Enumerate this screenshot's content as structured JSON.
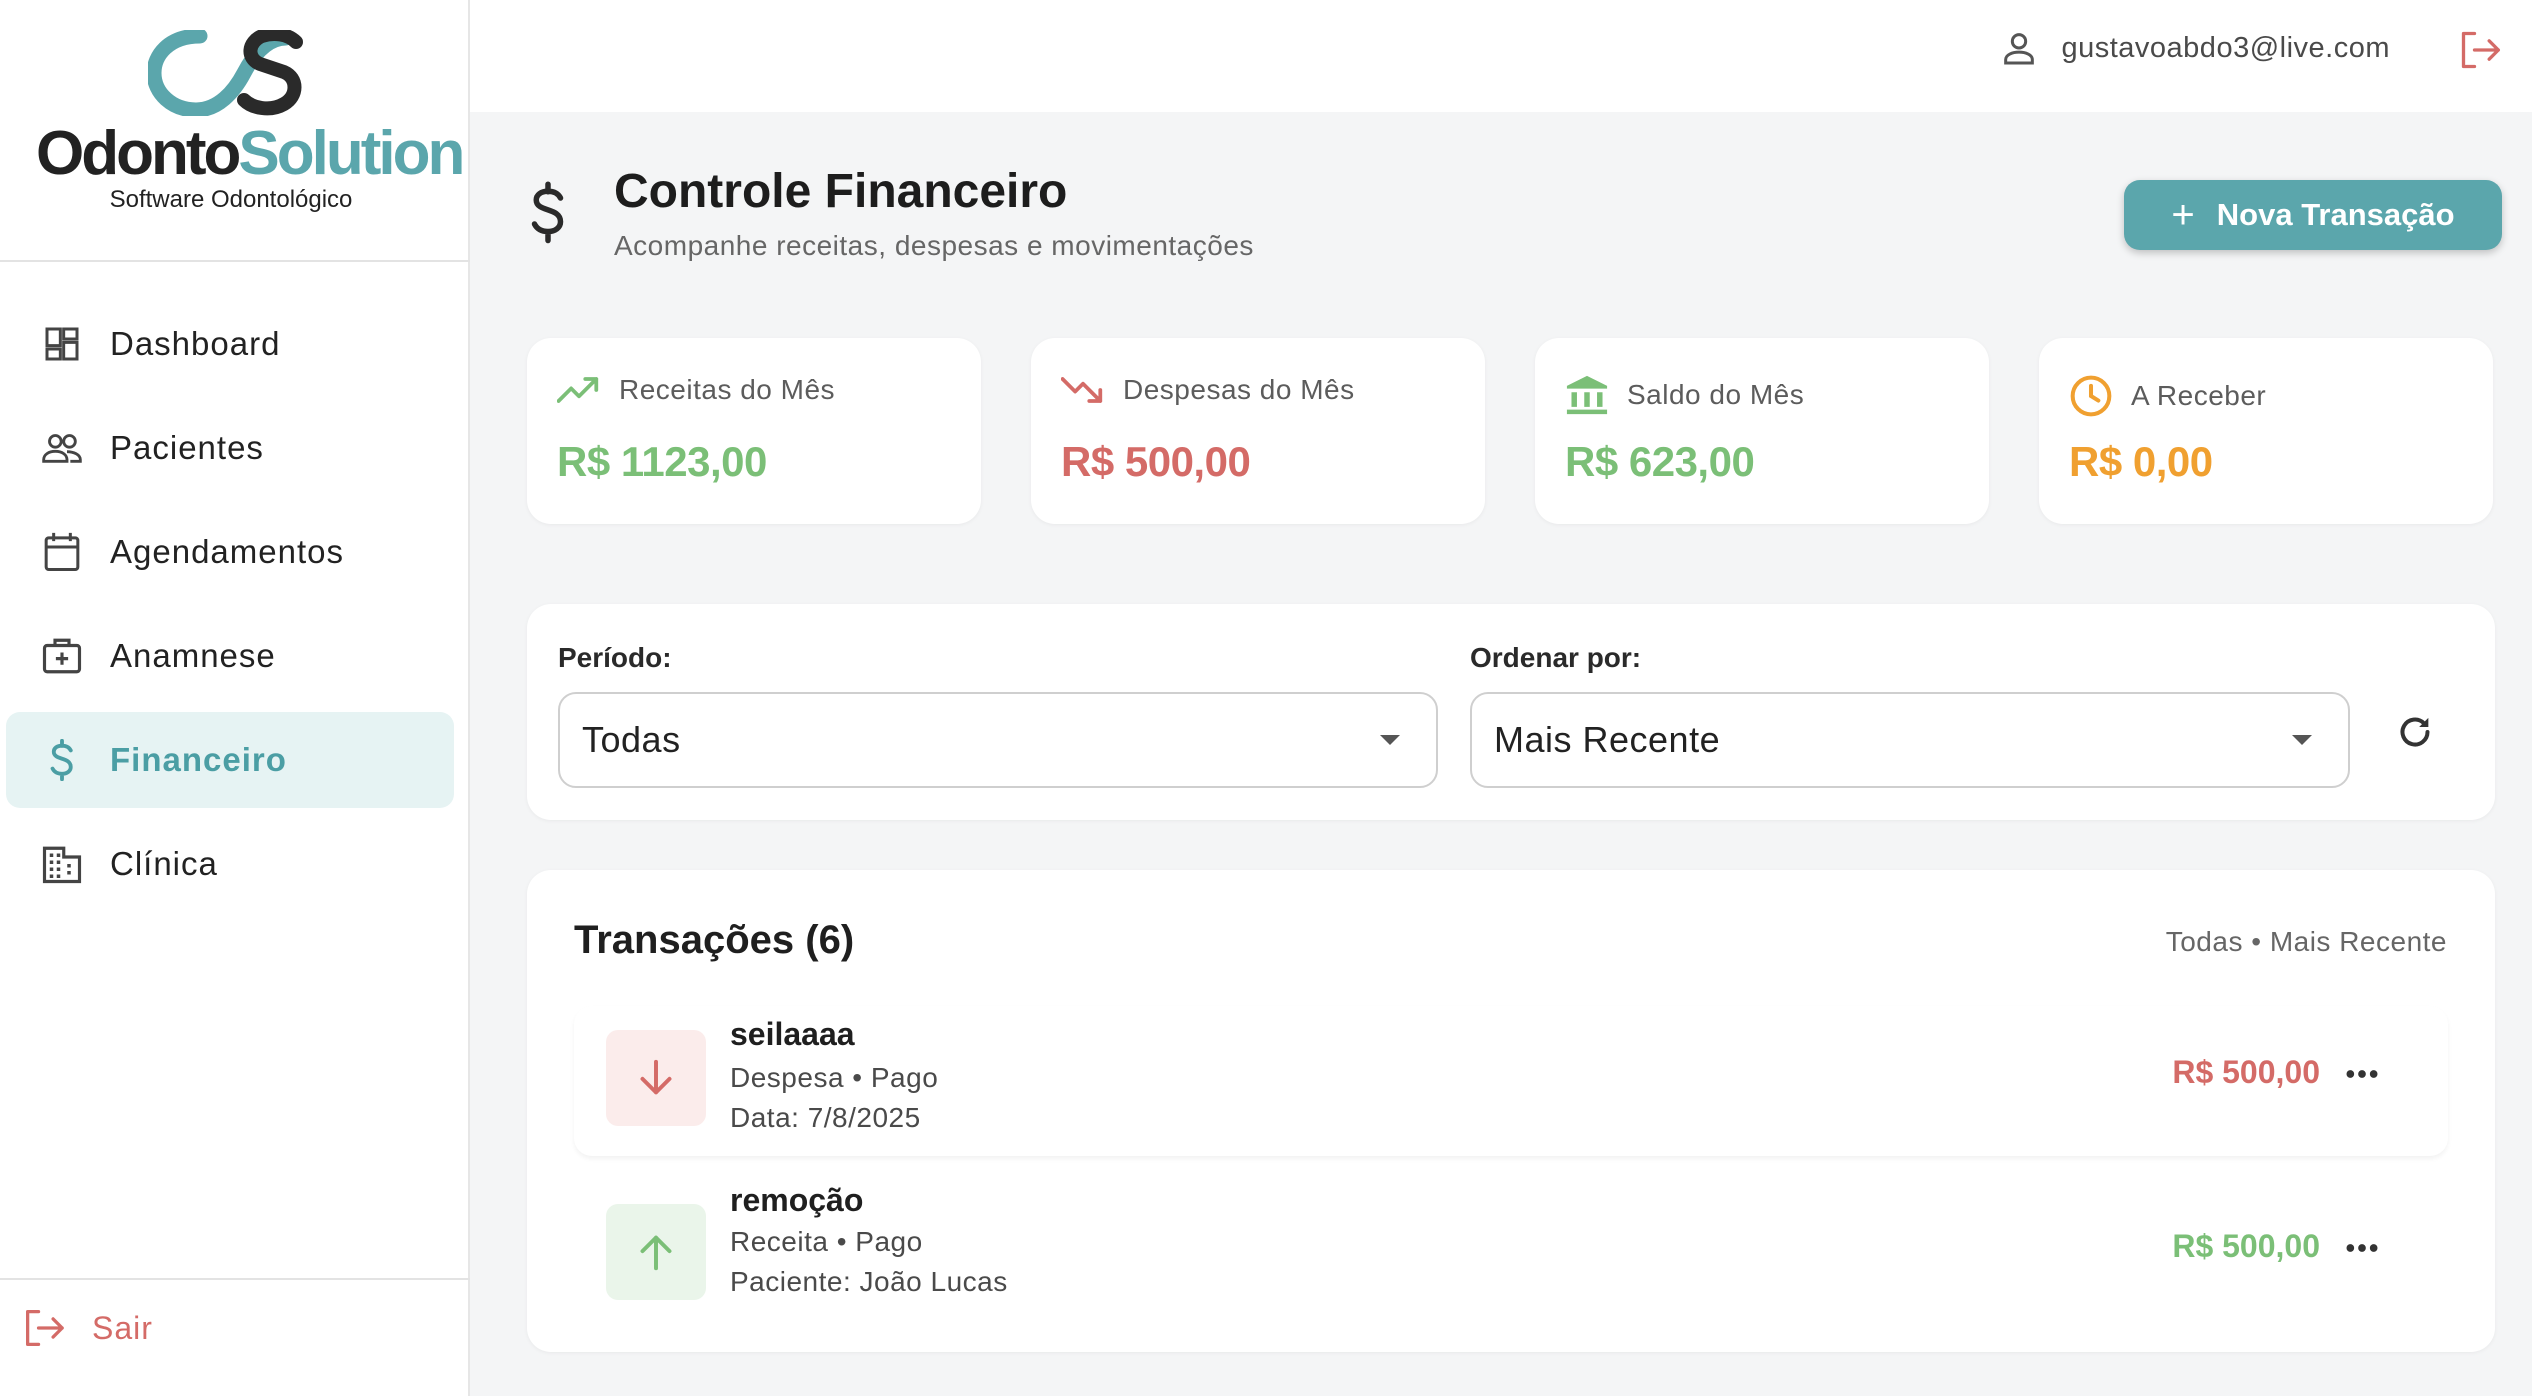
{
  "brand": {
    "name_part1": "Odonto",
    "name_part2": "Solution",
    "tagline": "Software Odontológico",
    "colors": {
      "primary": "#5ba6ac",
      "dark": "#222222"
    }
  },
  "sidebar": {
    "items": [
      {
        "label": "Dashboard",
        "icon": "dashboard-icon",
        "active": false
      },
      {
        "label": "Pacientes",
        "icon": "people-icon",
        "active": false
      },
      {
        "label": "Agendamentos",
        "icon": "calendar-icon",
        "active": false
      },
      {
        "label": "Anamnese",
        "icon": "medical-case-icon",
        "active": false
      },
      {
        "label": "Financeiro",
        "icon": "dollar-icon",
        "active": true
      },
      {
        "label": "Clínica",
        "icon": "building-icon",
        "active": false
      }
    ],
    "logout_label": "Sair"
  },
  "topbar": {
    "user_email": "gustavoabdo3@live.com"
  },
  "page": {
    "title": "Controle Financeiro",
    "subtitle": "Acompanhe receitas, despesas e movimentações",
    "new_button_label": "Nova Transação"
  },
  "stats": [
    {
      "label": "Receitas do Mês",
      "value": "R$ 1123,00",
      "icon": "trending-up-icon",
      "color": "#7bbf77"
    },
    {
      "label": "Despesas do Mês",
      "value": "R$ 500,00",
      "icon": "trending-down-icon",
      "color": "#d46b67"
    },
    {
      "label": "Saldo do Mês",
      "value": "R$ 623,00",
      "icon": "bank-icon",
      "color": "#7bbf77"
    },
    {
      "label": "A Receber",
      "value": "R$ 0,00",
      "icon": "clock-icon",
      "color": "#f0a030"
    }
  ],
  "filters": {
    "period_label": "Período:",
    "period_value": "Todas",
    "order_label": "Ordenar por:",
    "order_value": "Mais Recente"
  },
  "transactions": {
    "title": "Transações (6)",
    "meta": "Todas • Mais Recente",
    "items": [
      {
        "name": "seilaaaa",
        "type_status": "Despesa • Pago",
        "detail": "Data: 7/8/2025",
        "amount": "R$ 500,00",
        "kind": "despesa"
      },
      {
        "name": "remoção",
        "type_status": "Receita • Pago",
        "detail": "Paciente: João Lucas",
        "amount": "R$ 500,00",
        "kind": "receita"
      }
    ]
  }
}
